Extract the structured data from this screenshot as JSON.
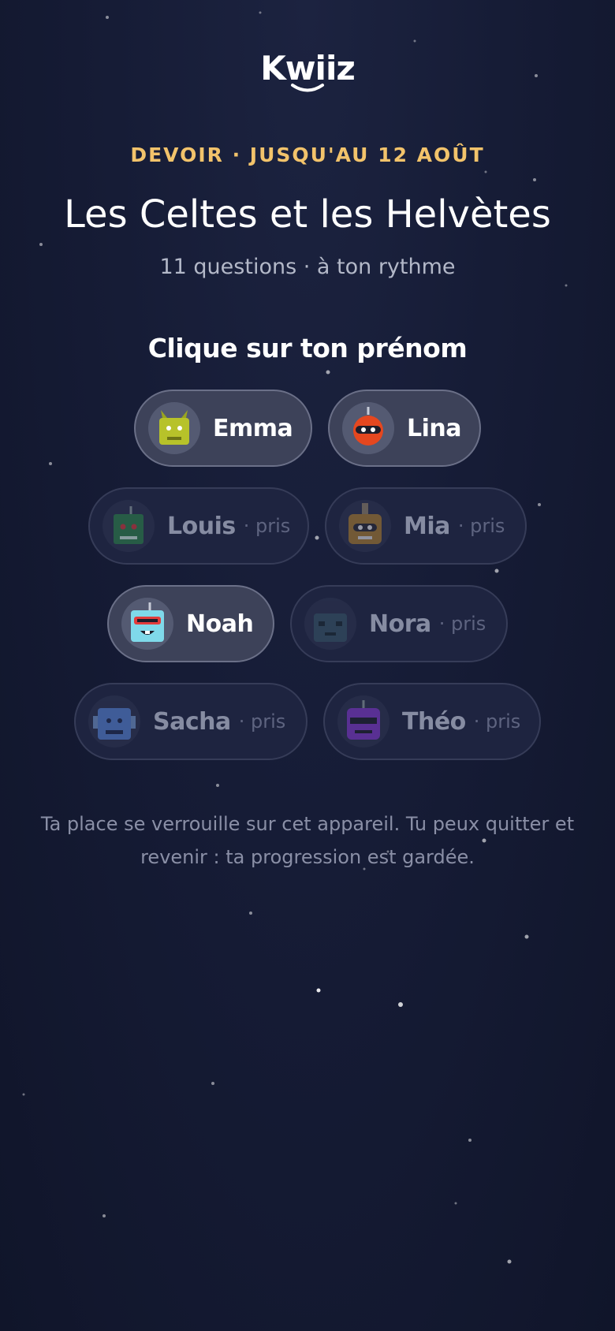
{
  "header": {
    "logo": "Kwiiz"
  },
  "assignment": {
    "deadline": "DEVOIR · JUSQU'AU 12 AOÛT",
    "title": "Les Celtes et les Helvètes",
    "subtitle": "11 questions · à ton rythme"
  },
  "picker": {
    "prompt": "Clique sur ton prénom",
    "taken_label": "· pris",
    "students": [
      {
        "name": "Emma",
        "taken": false,
        "avatar": "yellow-horned-robot-icon"
      },
      {
        "name": "Lina",
        "taken": false,
        "avatar": "red-masked-robot-icon"
      },
      {
        "name": "Louis",
        "taken": true,
        "avatar": "green-robot-icon"
      },
      {
        "name": "Mia",
        "taken": true,
        "avatar": "brown-robot-icon"
      },
      {
        "name": "Noah",
        "taken": false,
        "avatar": "cyan-visor-robot-icon"
      },
      {
        "name": "Nora",
        "taken": true,
        "avatar": "teal-robot-icon"
      },
      {
        "name": "Sacha",
        "taken": true,
        "avatar": "blue-robot-icon"
      },
      {
        "name": "Théo",
        "taken": true,
        "avatar": "purple-robot-icon"
      }
    ]
  },
  "footnote": "Ta place se verrouille sur cet appareil. Tu peux quitter et revenir : ta progression est gardée.",
  "colors": {
    "accent": "#f2c36b",
    "background": "#161c36"
  }
}
